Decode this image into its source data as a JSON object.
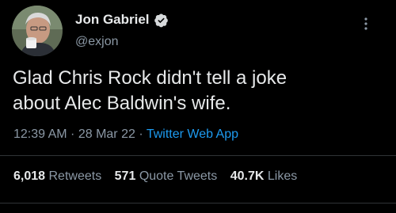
{
  "author": {
    "display_name": "Jon Gabriel",
    "handle": "@exjon",
    "verified_icon": "verified-badge-icon"
  },
  "tweet": {
    "text_line1": "Glad Chris Rock didn't tell a joke",
    "text_line2": "about Alec Baldwin's wife.",
    "time": "12:39 AM",
    "separator": " · ",
    "date": "28 Mar 22",
    "source": "Twitter Web App"
  },
  "stats": {
    "retweets_count": "6,018",
    "retweets_label": "Retweets",
    "quotes_count": "571",
    "quotes_label": "Quote Tweets",
    "likes_count": "40.7K",
    "likes_label": "Likes"
  },
  "colors": {
    "background": "#000000",
    "text_primary": "#e7e9ea",
    "text_secondary": "#8b98a5",
    "link": "#1d9bf0",
    "divider": "#2f3336"
  }
}
